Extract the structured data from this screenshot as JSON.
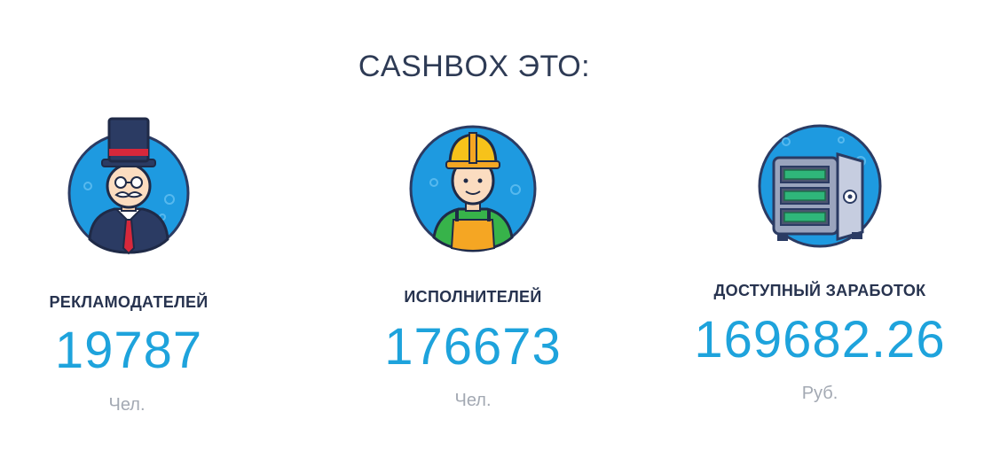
{
  "header": {
    "title": "CASHBOX ЭТО:"
  },
  "stats": [
    {
      "icon": "businessman-icon",
      "label": "РЕКЛАМОДАТЕЛЕЙ",
      "value": "19787",
      "unit": "Чел."
    },
    {
      "icon": "worker-icon",
      "label": "ИСПОЛНИТЕЛЕЙ",
      "value": "176673",
      "unit": "Чел."
    },
    {
      "icon": "safe-icon",
      "label": "ДОСТУПНЫЙ ЗАРАБОТОК",
      "value": "169682.26",
      "unit": "Руб."
    }
  ],
  "colors": {
    "title": "#2e3b55",
    "label": "#27334f",
    "value": "#1ea3dc",
    "unit": "#a3a9b3",
    "circle": "#1e9ae0",
    "outline": "#2b3b63"
  }
}
